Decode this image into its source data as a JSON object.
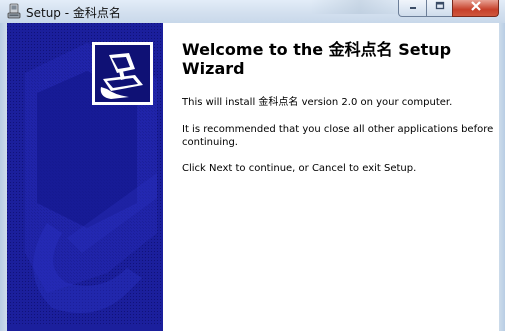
{
  "window": {
    "title": "Setup - 金科点名",
    "controls": {
      "minimize_icon": "minimize-icon",
      "maximize_icon": "maximize-icon",
      "close_icon": "close-icon"
    }
  },
  "wizard": {
    "heading": "Welcome to the 金科点名 Setup Wizard",
    "install_text": "This will install 金科点名 version 2.0 on your computer.",
    "recommend_text": "It is recommended that you close all other applications before continuing.",
    "next_text": "Click Next to continue, or Cancel to exit Setup."
  },
  "colors": {
    "panel_blue": "#1b1f9c",
    "panel_dark": "#0f1175",
    "close_red": "#c6402a"
  }
}
